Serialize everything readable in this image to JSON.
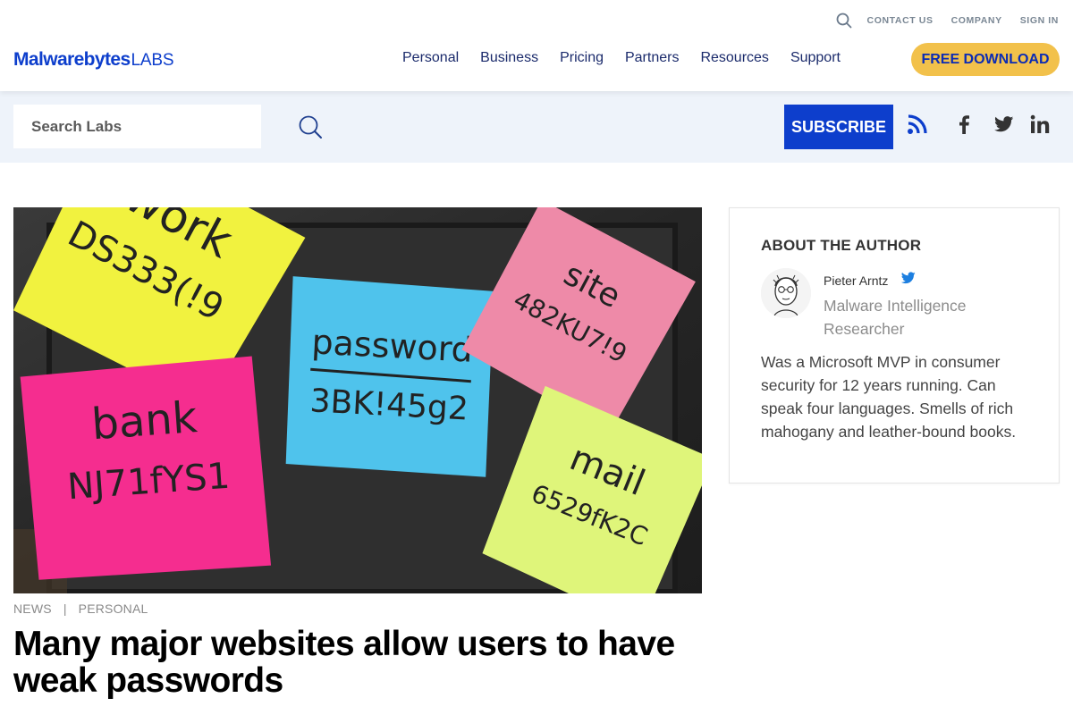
{
  "brand": {
    "logo_main": "Malwarebytes",
    "logo_sub": "LABS",
    "accent": "#0d3ecc",
    "cta_color": "#f2c14b"
  },
  "utility_nav": {
    "search_icon": "search-icon",
    "links": [
      "CONTACT US",
      "COMPANY",
      "SIGN IN"
    ]
  },
  "main_nav": {
    "items": [
      "Personal",
      "Business",
      "Pricing",
      "Partners",
      "Resources",
      "Support"
    ],
    "cta_label": "FREE DOWNLOAD"
  },
  "subbar": {
    "search_placeholder": "Search Labs",
    "search_icon": "search-icon",
    "subscribe_label": "SUBSCRIBE",
    "social_icons": [
      "rss-icon",
      "facebook-icon",
      "twitter-icon",
      "linkedin-icon"
    ]
  },
  "article": {
    "hero_notes": [
      {
        "heading": "work",
        "code": "DS333(!9"
      },
      {
        "heading": "password",
        "code": "3BK!45g2"
      },
      {
        "heading": "site",
        "code": "482KU7!9"
      },
      {
        "heading": "bank",
        "code": "NJ71fYS1"
      },
      {
        "heading": "mail",
        "code": "6529fK2C"
      }
    ],
    "categories": [
      "NEWS",
      "PERSONAL"
    ],
    "category_separator": "|",
    "title": "Many major websites allow users to have weak passwords"
  },
  "author": {
    "heading": "ABOUT THE AUTHOR",
    "name": "Pieter Arntz",
    "role": "Malware Intelligence Researcher",
    "bio": "Was a Microsoft MVP in consumer security for 12 years running. Can speak four languages. Smells of rich mahogany and leather-bound books.",
    "twitter_icon": "twitter-icon"
  }
}
